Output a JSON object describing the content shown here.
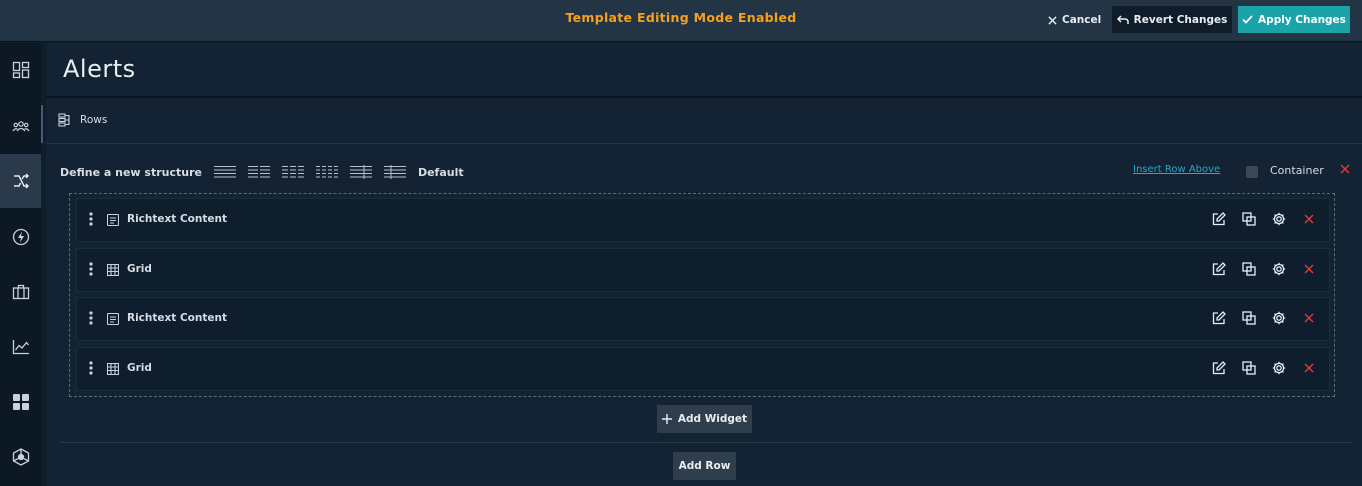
{
  "topbar": {
    "mode_text": "Template Editing Mode Enabled",
    "cancel_label": "Cancel",
    "revert_label": "Revert Changes",
    "apply_label": "Apply Changes"
  },
  "sidebar": {
    "items": [
      {
        "icon": "dashboard-icon"
      },
      {
        "icon": "users-icon"
      },
      {
        "icon": "shuffle-icon",
        "active": true
      },
      {
        "icon": "bolt-icon"
      },
      {
        "icon": "briefcase-icon"
      },
      {
        "icon": "chart-line-icon"
      },
      {
        "icon": "apps-grid-icon"
      },
      {
        "icon": "network-icon"
      }
    ]
  },
  "page": {
    "title": "Alerts",
    "rows_label": "Rows",
    "structure_label": "Define a new structure",
    "structure_default": "Default",
    "insert_row_above": "Insert Row Above",
    "container_label": "Container"
  },
  "widgets": [
    {
      "name": "Richtext Content",
      "type_icon": "richtext-icon"
    },
    {
      "name": "Grid",
      "type_icon": "grid-table-icon"
    },
    {
      "name": "Richtext Content",
      "type_icon": "richtext-icon"
    },
    {
      "name": "Grid",
      "type_icon": "grid-table-icon"
    }
  ],
  "actions": {
    "add_widget_label": "Add Widget",
    "add_row_label": "Add Row"
  },
  "colors": {
    "accent_orange": "#f5a11c",
    "apply_teal": "#1aa3a8",
    "danger_red": "#e03a3a",
    "link_blue": "#2aa7c9"
  }
}
